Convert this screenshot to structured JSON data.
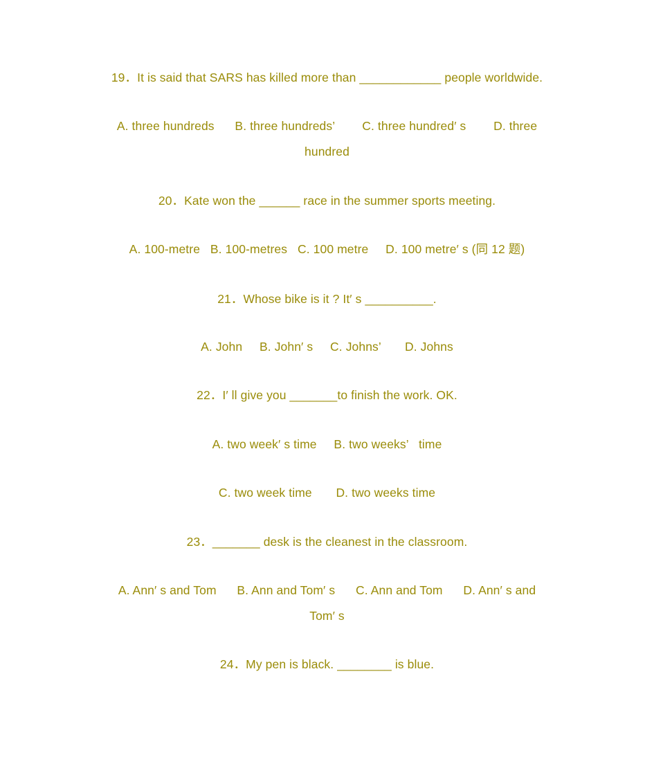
{
  "document": {
    "type": "english-grammar-worksheet",
    "text_color": "#9a8c09",
    "background_color": "#ffffff",
    "questions": [
      {
        "number": "19",
        "stem": "19．It is said that SARS has killed more than ____________ people worldwide.",
        "options_line1": "A. three hundreds      B. three hundreds’        C. three hundred′ s        D. three",
        "options_line2": "hundred"
      },
      {
        "number": "20",
        "stem": "20．Kate won the ______ race in the summer sports meeting.",
        "options_line1": "A. 100-metre   B. 100-metres   C. 100 metre     D. 100 metre′ s (同 12 题)"
      },
      {
        "number": "21",
        "stem": "21．Whose bike is it ? It′ s __________.",
        "options_line1": "A. John     B. John′ s     C. Johns’       D. Johns"
      },
      {
        "number": "22",
        "stem": "22．I′ ll give you _______to finish the work. OK.",
        "options_line1": "A. two week′ s time     B. two weeks’   time",
        "options_line2": "C. two week time       D. two weeks time"
      },
      {
        "number": "23",
        "stem": "23．_______ desk is the cleanest in the classroom.",
        "options_line1": "A. Ann′ s and Tom      B. Ann and Tom′ s      C. Ann and Tom      D. Ann′ s and",
        "options_line2": "Tom′ s"
      },
      {
        "number": "24",
        "stem": "24．My pen is black. ________ is blue."
      }
    ]
  }
}
